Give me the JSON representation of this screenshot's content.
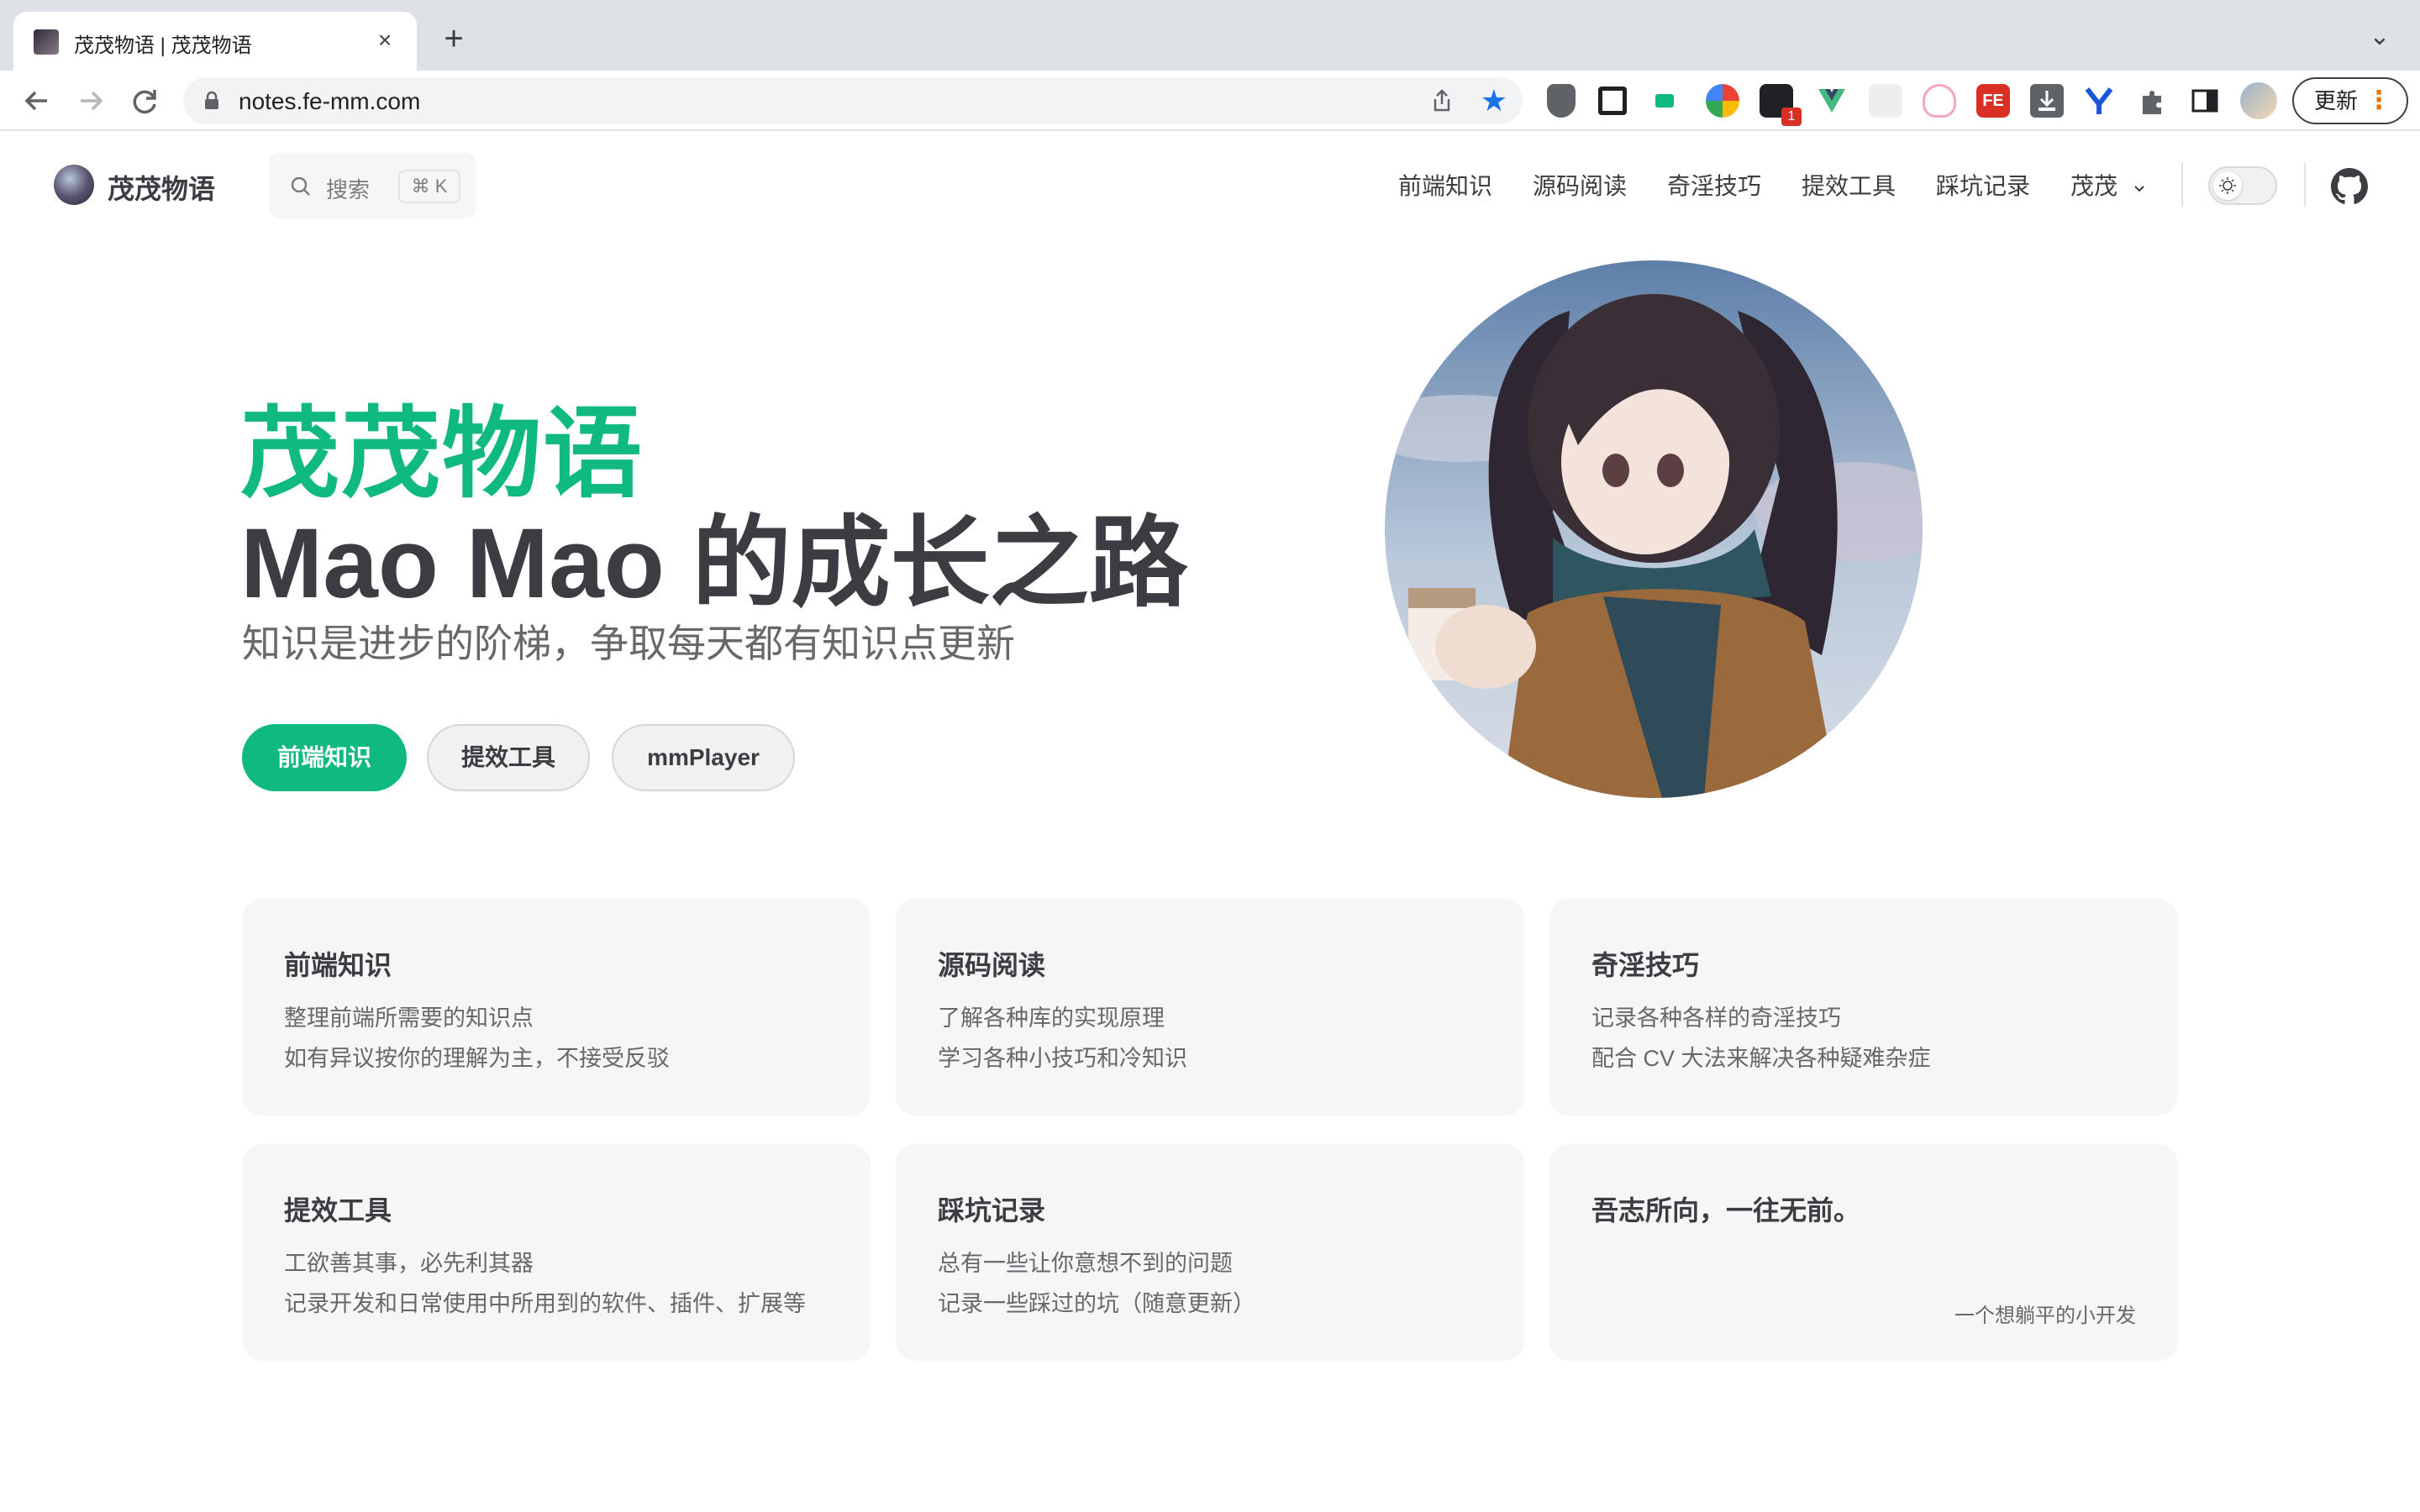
{
  "browser": {
    "tab_title": "茂茂物语 | 茂茂物语",
    "tab_close": "×",
    "new_tab": "+",
    "tab_dropdown": "⌄",
    "url": "notes.fe-mm.com",
    "update_label": "更新",
    "update_dots": "⋮",
    "extension_badge": "1"
  },
  "site": {
    "brand": "茂茂物语",
    "search_label": "搜索",
    "search_shortcut": "⌘ K",
    "nav": [
      "前端知识",
      "源码阅读",
      "奇淫技巧",
      "提效工具",
      "踩坑记录",
      "茂茂"
    ],
    "nav_dropdown_icon": "chevron-down-icon",
    "accent_color": "#10b981"
  },
  "hero": {
    "name": "茂茂物语",
    "text": "Mao Mao 的成长之路",
    "tagline": "知识是进步的阶梯，争取每天都有知识点更新",
    "actions": [
      "前端知识",
      "提效工具",
      "mmPlayer"
    ]
  },
  "features": [
    {
      "title": "前端知识",
      "lines": [
        "整理前端所需要的知识点",
        "如有异议按你的理解为主，不接受反驳"
      ]
    },
    {
      "title": "源码阅读",
      "lines": [
        "了解各种库的实现原理",
        "学习各种小技巧和冷知识"
      ]
    },
    {
      "title": "奇淫技巧",
      "lines": [
        "记录各种各样的奇淫技巧",
        "配合 CV 大法来解决各种疑难杂症"
      ]
    },
    {
      "title": "提效工具",
      "lines": [
        "工欲善其事，必先利其器",
        "记录开发和日常使用中所用到的软件、插件、扩展等"
      ]
    },
    {
      "title": "踩坑记录",
      "lines": [
        "总有一些让你意想不到的问题",
        "记录一些踩过的坑（随意更新）"
      ]
    },
    {
      "title": "吾志所向，一往无前。",
      "lines": [],
      "sign": "一个想躺平的小开发"
    }
  ]
}
